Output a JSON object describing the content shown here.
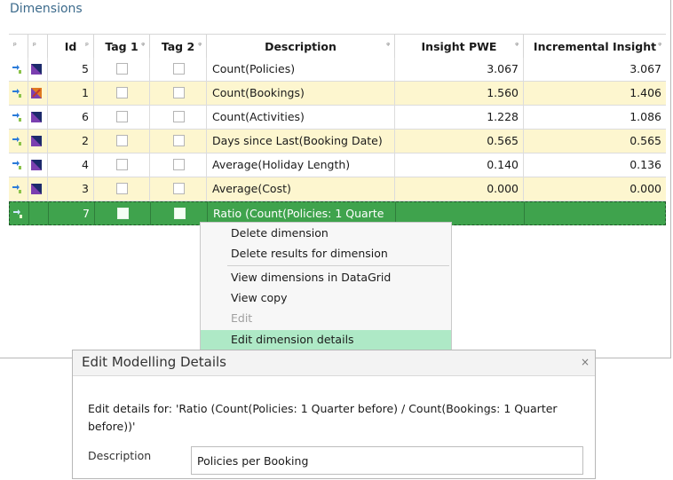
{
  "panel": {
    "title": "Dimensions"
  },
  "grid": {
    "pin_glyph": "ᵖ",
    "filter_glyph": "ᵠ",
    "columns": [
      "",
      "",
      "Id",
      "Tag 1",
      "Tag 2",
      "Description",
      "Insight PWE",
      "Incremental Insight"
    ],
    "rows": [
      {
        "id": "5",
        "description": "Count(Policies)",
        "pwe": "3.067",
        "inc": "3.067"
      },
      {
        "id": "1",
        "description": "Count(Bookings)",
        "pwe": "1.560",
        "inc": "1.406"
      },
      {
        "id": "6",
        "description": "Count(Activities)",
        "pwe": "1.228",
        "inc": "1.086"
      },
      {
        "id": "2",
        "description": "Days since Last(Booking Date)",
        "pwe": "0.565",
        "inc": "0.565"
      },
      {
        "id": "4",
        "description": "Average(Holiday Length)",
        "pwe": "0.140",
        "inc": "0.136"
      },
      {
        "id": "3",
        "description": "Average(Cost)",
        "pwe": "0.000",
        "inc": "0.000"
      },
      {
        "id": "7",
        "description": "Ratio (Count(Policies: 1 Quarte",
        "pwe": "",
        "inc": ""
      }
    ],
    "colors": {
      "even_row": "#fdf6cf",
      "selected_row": "#3fa34d"
    }
  },
  "context_menu": {
    "items": [
      {
        "label": "Delete dimension",
        "disabled": false
      },
      {
        "label": "Delete results for dimension",
        "disabled": false
      },
      {
        "label": "View dimensions in DataGrid",
        "disabled": false
      },
      {
        "label": "View copy",
        "disabled": false
      },
      {
        "label": "Edit",
        "disabled": true
      },
      {
        "label": "Edit dimension details",
        "disabled": false,
        "highlighted": true
      }
    ]
  },
  "dialog": {
    "title": "Edit Modelling Details",
    "close_glyph": "×",
    "message": "Edit details for: 'Ratio (Count(Policies: 1 Quarter before) / Count(Bookings: 1 Quarter before))'",
    "description_label": "Description",
    "description_value": "Policies per Booking"
  }
}
